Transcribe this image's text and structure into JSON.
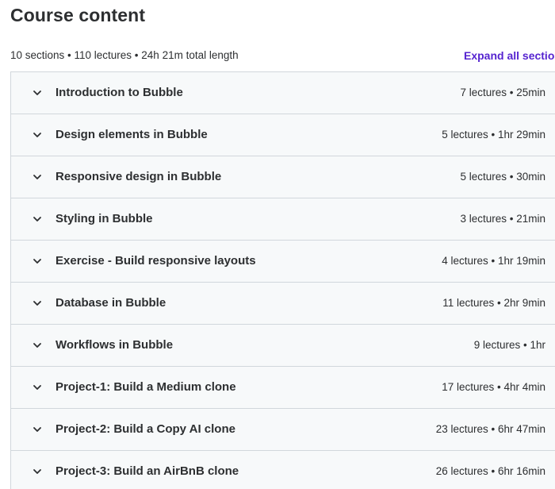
{
  "header": {
    "title": "Course content",
    "summary": "10 sections • 110 lectures • 24h 21m total length",
    "expand_label": "Expand all sections"
  },
  "colors": {
    "accent": "#5624d0",
    "row_bg": "#f7f9fa",
    "border": "#d1d7dc",
    "text": "#2d2f31"
  },
  "icons": {
    "section_toggle": "chevron-down-icon"
  },
  "sections": [
    {
      "title": "Introduction to Bubble",
      "meta": "7 lectures • 25min"
    },
    {
      "title": "Design elements in Bubble",
      "meta": "5 lectures • 1hr 29min"
    },
    {
      "title": "Responsive design in Bubble",
      "meta": "5 lectures • 30min"
    },
    {
      "title": "Styling in Bubble",
      "meta": "3 lectures • 21min"
    },
    {
      "title": "Exercise - Build responsive layouts",
      "meta": "4 lectures • 1hr 19min"
    },
    {
      "title": "Database in Bubble",
      "meta": "11 lectures • 2hr 9min"
    },
    {
      "title": "Workflows in Bubble",
      "meta": "9 lectures • 1hr"
    },
    {
      "title": "Project-1: Build a Medium clone",
      "meta": "17 lectures • 4hr 4min"
    },
    {
      "title": "Project-2: Build a Copy AI clone",
      "meta": "23 lectures • 6hr 47min"
    },
    {
      "title": "Project-3: Build an AirBnB clone",
      "meta": "26 lectures • 6hr 16min"
    }
  ]
}
